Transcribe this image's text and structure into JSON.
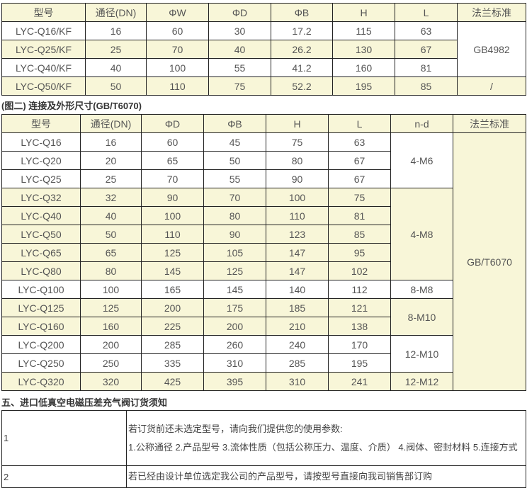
{
  "table1": {
    "headers": [
      "型号",
      "通径(DN)",
      "ΦW",
      "ΦD",
      "ΦB",
      "H",
      "L",
      "法兰标准"
    ],
    "rows": [
      [
        "LYC-Q16/KF",
        "16",
        "60",
        "30",
        "17.2",
        "115",
        "63"
      ],
      [
        "LYC-Q25/KF",
        "25",
        "70",
        "40",
        "26.2",
        "130",
        "67"
      ],
      [
        "LYC-Q40/KF",
        "40",
        "100",
        "55",
        "41.2",
        "160",
        "81"
      ],
      [
        "LYC-Q50/KF",
        "50",
        "110",
        "75",
        "52.2",
        "195",
        "85"
      ]
    ],
    "std_merged": "GB4982",
    "std_last": "/"
  },
  "caption2": "(图二) 连接及外形尺寸(GB/T6070)",
  "table2": {
    "headers": [
      "型号",
      "通径(DN)",
      "ΦD",
      "ΦB",
      "H",
      "L",
      "n-d",
      "法兰标准"
    ],
    "rows": [
      [
        "LYC-Q16",
        "16",
        "60",
        "45",
        "75",
        "63"
      ],
      [
        "LYC-Q20",
        "20",
        "65",
        "50",
        "80",
        "67"
      ],
      [
        "LYC-Q25",
        "25",
        "70",
        "55",
        "90",
        "67"
      ],
      [
        "LYC-Q32",
        "32",
        "90",
        "70",
        "100",
        "75"
      ],
      [
        "LYC-Q40",
        "40",
        "100",
        "80",
        "110",
        "81"
      ],
      [
        "LYC-Q50",
        "50",
        "110",
        "90",
        "123",
        "85"
      ],
      [
        "LYC-Q65",
        "65",
        "125",
        "105",
        "147",
        "95"
      ],
      [
        "LYC-Q80",
        "80",
        "145",
        "125",
        "147",
        "102"
      ],
      [
        "LYC-Q100",
        "100",
        "165",
        "145",
        "140",
        "112"
      ],
      [
        "LYC-Q125",
        "125",
        "200",
        "175",
        "185",
        "121"
      ],
      [
        "LYC-Q160",
        "160",
        "225",
        "200",
        "210",
        "138"
      ],
      [
        "LYC-Q200",
        "200",
        "285",
        "260",
        "240",
        "170"
      ],
      [
        "LYC-Q250",
        "250",
        "335",
        "310",
        "285",
        "195"
      ],
      [
        "LYC-Q320",
        "320",
        "425",
        "395",
        "310",
        "241"
      ]
    ],
    "nd": [
      "4-M6",
      "4-M8",
      "8-M8",
      "8-M10",
      "12-M10",
      "12-M12"
    ],
    "std": "GB/T6070"
  },
  "section5": "五、进口低真空电磁压差充气阀订货须知",
  "table3": {
    "rows": [
      {
        "num": "1",
        "lines": [
          "若订货前还未选定型号，请向我们提供您的使用参数:",
          "1.公称通径 2.产品型号 3.流体性质（包括公称压力、温度、介质） 4.阀体、密封材料 5.连接方式"
        ]
      },
      {
        "num": "2",
        "lines": [
          "若已经由设计单位选定我公司的产品型号，请按型号直接向我司销售部订购"
        ]
      }
    ]
  }
}
